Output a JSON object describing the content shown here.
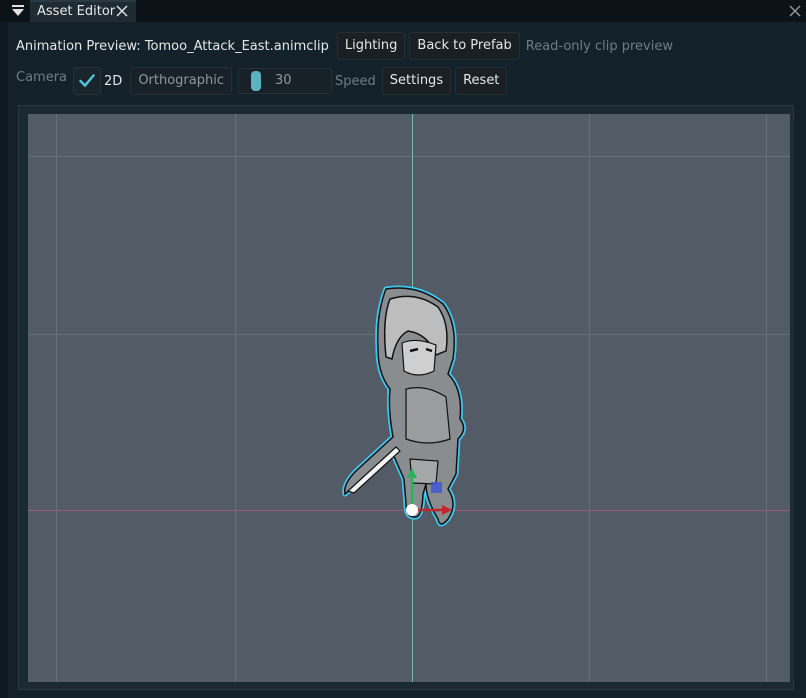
{
  "tab": {
    "title": "Asset Editor"
  },
  "toolbar": {
    "preview_label": "Animation Preview: Tomoo_Attack_East.animclip",
    "lighting_label": "Lighting",
    "back_label": "Back to Prefab",
    "readonly_label": "Read-only clip preview"
  },
  "camera": {
    "label": "Camera",
    "toggle_2d_label": "2D",
    "toggle_2d_checked": true,
    "orthographic_label": "Orthographic",
    "speed_value": "30",
    "speed_label": "Speed",
    "settings_label": "Settings",
    "reset_label": "Reset"
  },
  "viewport": {
    "background": "#525b66",
    "grid_color": "#66707a",
    "y_axis_color": "#7fb8a6",
    "x_axis_color": "#a05a7a",
    "selection_outline_color": "#3fc6ee"
  },
  "icons": {
    "tab_menu": "triangle-down-icon",
    "tab_close": "close-icon",
    "window_close": "close-icon",
    "checkbox": "checkmark-icon"
  }
}
